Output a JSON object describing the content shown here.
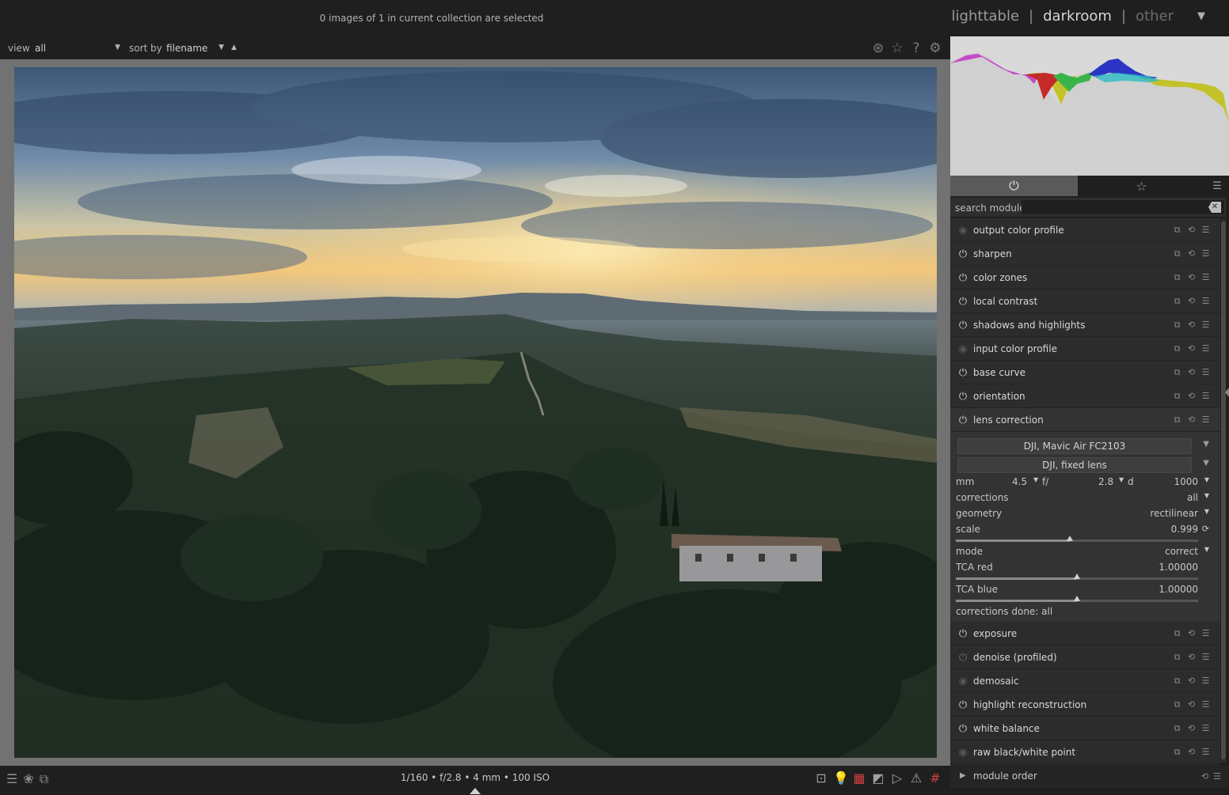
{
  "header": {
    "collection_info": "0 images of 1 in current collection are selected",
    "views": {
      "lighttable": "lighttable",
      "darkroom": "darkroom",
      "other": "other",
      "separator": "|"
    }
  },
  "filterbar": {
    "view_label": "view",
    "view_value": "all",
    "sort_label": "sort by",
    "sort_value": "filename",
    "icons": [
      "color-picker-icon",
      "star-icon",
      "help-icon",
      "gear-icon"
    ]
  },
  "right_panel": {
    "tabs": [
      {
        "name": "active-modules-tab",
        "icon": "power-icon",
        "active": true
      },
      {
        "name": "favorites-tab",
        "icon": "star-outline-icon",
        "active": false
      }
    ],
    "search_label": "search module",
    "search_value": "",
    "modules": [
      {
        "name": "output color profile",
        "state": "always-on"
      },
      {
        "name": "sharpen",
        "state": "on"
      },
      {
        "name": "color zones",
        "state": "on"
      },
      {
        "name": "local contrast",
        "state": "on"
      },
      {
        "name": "shadows and highlights",
        "state": "on"
      },
      {
        "name": "input color profile",
        "state": "always-on"
      },
      {
        "name": "base curve",
        "state": "on"
      },
      {
        "name": "orientation",
        "state": "on"
      },
      {
        "name": "lens correction",
        "state": "on",
        "expanded": true
      }
    ],
    "lens_correction": {
      "camera": "DJI, Mavic Air FC2103",
      "lens": "DJI, fixed lens",
      "mm_label": "mm",
      "mm_value": "4.5",
      "f_label": "f/",
      "f_value": "2.8",
      "d_label": "d",
      "d_value": "1000",
      "corrections_label": "corrections",
      "corrections_value": "all",
      "geometry_label": "geometry",
      "geometry_value": "rectilinear",
      "scale_label": "scale",
      "scale_value": "0.999",
      "scale_fraction": 0.47,
      "mode_label": "mode",
      "mode_value": "correct",
      "tca_red_label": "TCA red",
      "tca_red_value": "1.00000",
      "tca_red_fraction": 0.5,
      "tca_blue_label": "TCA blue",
      "tca_blue_value": "1.00000",
      "tca_blue_fraction": 0.5,
      "status": "corrections done: all"
    },
    "modules_after": [
      {
        "name": "exposure",
        "state": "on"
      },
      {
        "name": "denoise (profiled)",
        "state": "off"
      },
      {
        "name": "demosaic",
        "state": "always-on"
      },
      {
        "name": "highlight reconstruction",
        "state": "on"
      },
      {
        "name": "white balance",
        "state": "on"
      },
      {
        "name": "raw black/white point",
        "state": "always-on"
      }
    ],
    "module_order_label": "module order"
  },
  "bottombar": {
    "exif": "1/160 • f/2.8 • 4 mm • 100 ISO",
    "left_icons": [
      "presets-icon",
      "styles-icon",
      "second-window-icon"
    ],
    "right_icons": [
      "focus-peaking-icon",
      "bulb-icon",
      "color-assessment-icon",
      "raw-overexposed-icon",
      "softproof-icon",
      "gamut-check-icon",
      "guides-icon"
    ]
  }
}
